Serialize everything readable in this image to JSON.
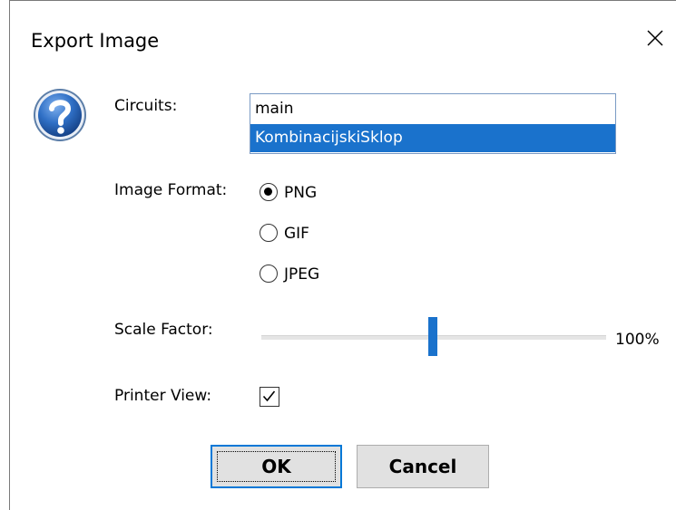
{
  "window": {
    "title": "Export Image"
  },
  "icons": {
    "dialog_icon": "question-icon",
    "close": "close-icon",
    "check": "checkmark-icon"
  },
  "form": {
    "circuits_label": "Circuits:",
    "circuits": [
      "main",
      "KombinacijskiSklop"
    ],
    "selected_circuit": "KombinacijskiSklop",
    "image_format_label": "Image Format:",
    "image_formats": [
      "PNG",
      "GIF",
      "JPEG"
    ],
    "selected_format": "PNG",
    "scale_factor_label": "Scale Factor:",
    "scale_factor_value": "100%",
    "scale_slider_fraction": 0.5,
    "printer_view_label": "Printer View:",
    "printer_view_checked": true
  },
  "buttons": {
    "ok": "OK",
    "cancel": "Cancel"
  },
  "colors": {
    "accent": "#1a72cc",
    "icon_blue": "#2f6fc5"
  }
}
